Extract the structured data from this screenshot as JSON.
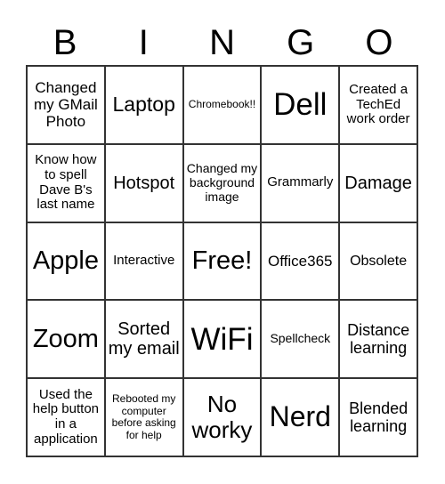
{
  "header": [
    "B",
    "I",
    "N",
    "G",
    "O"
  ],
  "cells": [
    [
      "Changed my GMail Photo",
      "Laptop",
      "Chromebook!!",
      "Dell",
      "Created a TechEd work order"
    ],
    [
      "Know how to spell Dave B's last name",
      "Hotspot",
      "Changed my background image",
      "Grammarly",
      "Damage"
    ],
    [
      "Apple",
      "Interactive",
      "Free!",
      "Office365",
      "Obsolete"
    ],
    [
      "Zoom",
      "Sorted my email",
      "WiFi",
      "Spellcheck",
      "Distance learning"
    ],
    [
      "Used the help button in a application",
      "Rebooted my computer before asking for help",
      "No worky",
      "Nerd",
      "Blended learning"
    ]
  ]
}
